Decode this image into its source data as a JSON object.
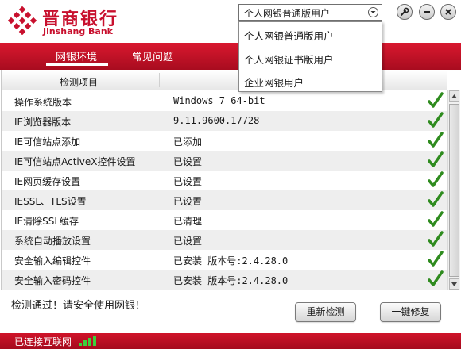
{
  "app": {
    "logo_cn": "晋商银行",
    "logo_en": "Jinshang Bank"
  },
  "user_type": {
    "selected": "个人网银普通版用户",
    "options": [
      "个人网银普通版用户",
      "个人网银证书版用户",
      "企业网银用户"
    ]
  },
  "tabs": [
    {
      "label": "网银环境",
      "active": true
    },
    {
      "label": "常见问题",
      "active": false
    }
  ],
  "table": {
    "header": "检测项目",
    "rows": [
      {
        "item": "操作系统版本",
        "status": "Windows 7 64-bit",
        "ok": true
      },
      {
        "item": "IE浏览器版本",
        "status": "9.11.9600.17728",
        "ok": true
      },
      {
        "item": "IE可信站点添加",
        "status": "已添加",
        "ok": true
      },
      {
        "item": "IE可信站点ActiveX控件设置",
        "status": "已设置",
        "ok": true
      },
      {
        "item": "IE网页缓存设置",
        "status": "已设置",
        "ok": true
      },
      {
        "item": "IESSL、TLS设置",
        "status": "已设置",
        "ok": true
      },
      {
        "item": "IE清除SSL缓存",
        "status": "已清理",
        "ok": true
      },
      {
        "item": "系统自动播放设置",
        "status": "已设置",
        "ok": true
      },
      {
        "item": "安全输入编辑控件",
        "status": "已安装 版本号:2.4.28.0",
        "ok": true
      },
      {
        "item": "安全输入密码控件",
        "status": "已安装 版本号:2.4.28.0",
        "ok": true
      }
    ]
  },
  "footer": {
    "result_message": "检测通过！请安全使用网银！",
    "recheck_label": "重新检测",
    "repair_label": "一键修复"
  },
  "statusbar": {
    "connection": "已连接互联网"
  },
  "colors": {
    "brand_red": "#c8102e",
    "check_green": "#2e8b1e"
  },
  "icons": {
    "tools": "wrench-icon",
    "minimize": "minimize-icon",
    "close": "close-icon",
    "status_ok": "check-icon",
    "signal": "signal-icon"
  }
}
